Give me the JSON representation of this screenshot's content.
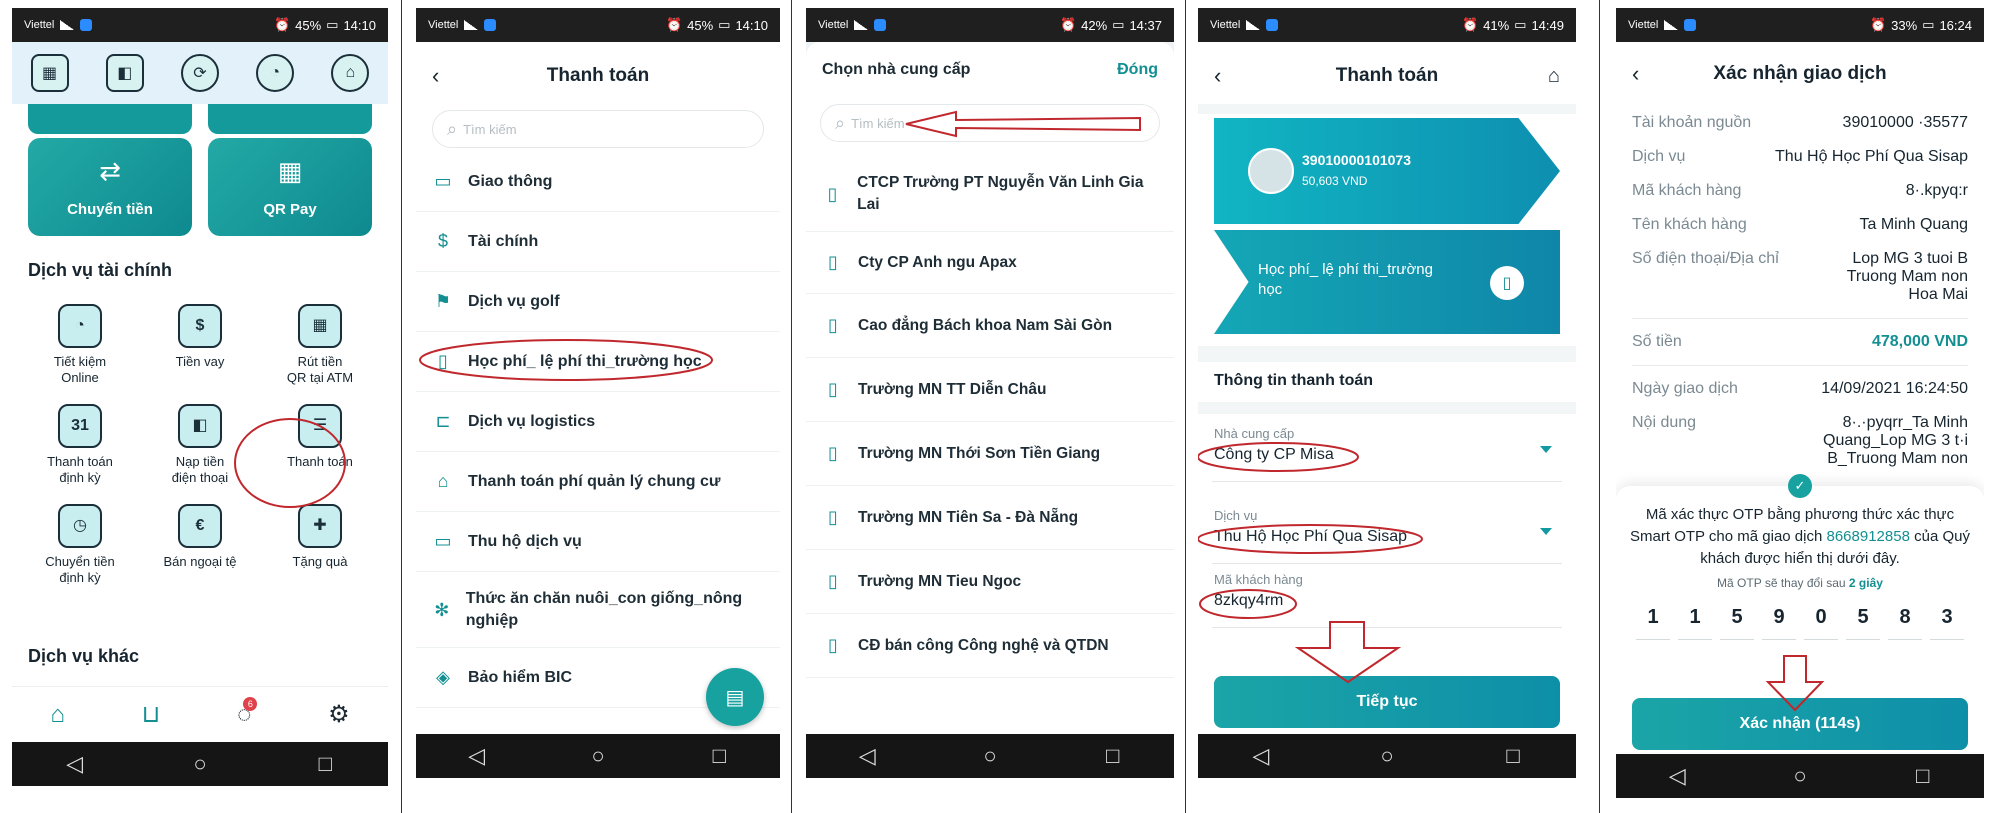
{
  "status": [
    {
      "carrier": "Viettel",
      "battery": "45%",
      "time": "14:10"
    },
    {
      "carrier": "Viettel",
      "battery": "45%",
      "time": "14:10"
    },
    {
      "carrier": "Viettel",
      "battery": "42%",
      "time": "14:37"
    },
    {
      "carrier": "Viettel",
      "battery": "41%",
      "time": "14:49"
    },
    {
      "carrier": "Viettel",
      "battery": "33%",
      "time": "16:24"
    }
  ],
  "screen1": {
    "big_buttons": [
      "Chuyển tiền",
      "QR Pay"
    ],
    "section_finance": "Dịch vụ tài chính",
    "finance_items": [
      {
        "line1": "Tiết kiệm",
        "line2": "Online"
      },
      {
        "line1": "Tiền vay",
        "line2": ""
      },
      {
        "line1": "Rút tiền",
        "line2": "QR tại ATM"
      },
      {
        "line1": "Thanh toán",
        "line2": "định kỳ"
      },
      {
        "line1": "Nạp tiền",
        "line2": "điện thoại"
      },
      {
        "line1": "Thanh toán",
        "line2": ""
      },
      {
        "line1": "Chuyển tiền",
        "line2": "định kỳ"
      },
      {
        "line1": "Bán ngoại tệ",
        "line2": ""
      },
      {
        "line1": "Tặng quà",
        "line2": ""
      }
    ],
    "section_other": "Dịch vụ khác"
  },
  "screen2": {
    "title": "Thanh toán",
    "search_placeholder": "Tìm kiếm",
    "menu": [
      "Giao thông",
      "Tài chính",
      "Dịch vụ golf",
      "Học phí_ lệ phí thi_trường học",
      "Dịch vụ logistics",
      "Thanh toán phí quản lý chung cư",
      "Thu hộ dịch vụ",
      "Thức ăn chăn nuôi_con giống_nông nghiệp",
      "Bảo hiểm BIC"
    ]
  },
  "screen3": {
    "title": "Chọn nhà cung cấp",
    "close": "Đóng",
    "search_placeholder": "Tìm kiếm",
    "providers": [
      "CTCP Trường PT Nguyễn Văn Linh Gia Lai",
      "Cty CP Anh ngu Apax",
      "Cao đẳng Bách khoa Nam Sài Gòn",
      "Trường MN TT Diễn Châu",
      "Trường MN Thới Sơn Tiền Giang",
      "Trường MN Tiên Sa - Đà Nẵng",
      "Trường MN Tieu Ngoc",
      "CĐ bán công Công nghệ và QTDN"
    ]
  },
  "screen4": {
    "title": "Thanh toán",
    "account_number": "39010000101073",
    "balance": "50,603 VND",
    "service_card": "Học phí_ lệ phí thi_trường học",
    "info_title": "Thông tin thanh toán",
    "fields": [
      {
        "label": "Nhà cung cấp",
        "value": "Công ty CP Misa"
      },
      {
        "label": "Dịch vụ",
        "value": "Thu Hộ Học Phí Qua Sisap"
      },
      {
        "label": "Mã khách hàng",
        "value": "8zkqy4rm"
      }
    ],
    "button": "Tiếp tục"
  },
  "screen5": {
    "title": "Xác nhận giao dịch",
    "rows": [
      {
        "k": "Tài khoản nguồn",
        "v": "39010000 ·35577"
      },
      {
        "k": "Dịch vụ",
        "v": "Thu Hộ Học Phí Qua Sisap"
      },
      {
        "k": "Mã khách hàng",
        "v": "8·.kpyq:r"
      },
      {
        "k": "Tên khách hàng",
        "v": "Ta Minh Quang"
      },
      {
        "k": "Số điện thoại/Địa chỉ",
        "v": "Lop MG 3 tuoi B Truong Mam non Hoa Mai"
      }
    ],
    "amount_label": "Số tiền",
    "amount": "478,000 VND",
    "date_label": "Ngày giao dịch",
    "date": "14/09/2021 16:24:50",
    "content_label": "Nội dung",
    "content": "8·.·pyqrr_Ta Minh Quang_Lop MG 3 t·i B_Truong Mam non",
    "otp_desc_pre": "Mã xác thực OTP bằng phương thức xác thực Smart OTP cho mã giao dịch",
    "otp_tx": "8668912858",
    "otp_desc_post": "của Quý khách được hiển thị dưới đây.",
    "otp_sub_pre": "Mã OTP sẽ thay đổi sau",
    "otp_sub_time": "2 giây",
    "otp_digits": [
      "1",
      "1",
      "5",
      "9",
      "0",
      "5",
      "8",
      "3"
    ],
    "button": "Xác nhận (114s)"
  }
}
